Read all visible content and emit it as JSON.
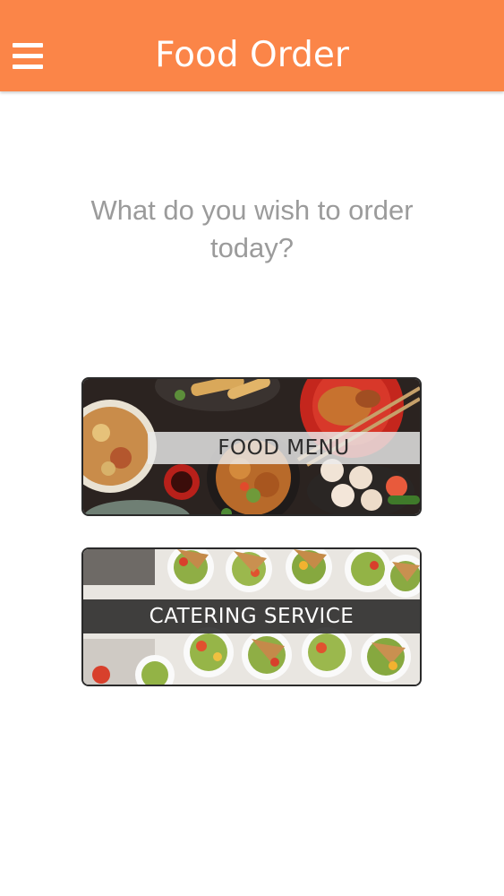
{
  "app_bar": {
    "title": "Food Order",
    "menu_icon": "hamburger-menu-icon",
    "color": "#fb8548"
  },
  "prompt": {
    "text": "What do you wish to order today?"
  },
  "options": [
    {
      "label": "FOOD MENU",
      "image": "asian-food-dishes-photo"
    },
    {
      "label": "CATERING SERVICE",
      "image": "catering-appetizer-cups-photo"
    }
  ]
}
